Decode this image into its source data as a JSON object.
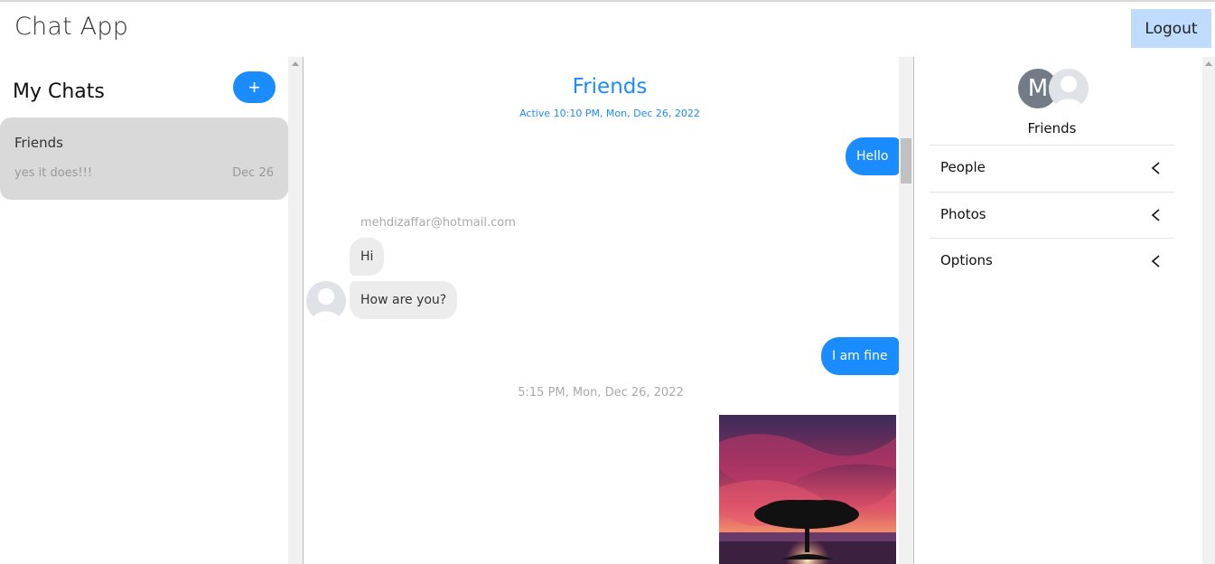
{
  "header": {
    "title": "Chat App",
    "logout_label": "Logout"
  },
  "sidebar": {
    "heading": "My Chats",
    "new_chat_icon": "+",
    "chats": [
      {
        "name": "Friends",
        "last_message": "yes it does!!!",
        "date": "Dec 26"
      }
    ]
  },
  "conversation": {
    "title": "Friends",
    "subtitle": "Active 10:10 PM, Mon, Dec 26, 2022",
    "messages": [
      {
        "text": "Hello"
      },
      {
        "sender": "mehdizaffar@hotmail.com"
      },
      {
        "text": "Hi"
      },
      {
        "text": "How are you?"
      },
      {
        "text": "I am fine"
      },
      {
        "timestamp": "5:15 PM, Mon, Dec 26, 2022"
      }
    ]
  },
  "details": {
    "avatar_initial": "M",
    "name": "Friends",
    "sections": [
      {
        "label": "People"
      },
      {
        "label": "Photos"
      },
      {
        "label": "Options"
      }
    ]
  },
  "colors": {
    "accent": "#1a8cff",
    "logout_bg": "#bfdbfe",
    "selected_chat_bg": "#d9d9d9"
  }
}
